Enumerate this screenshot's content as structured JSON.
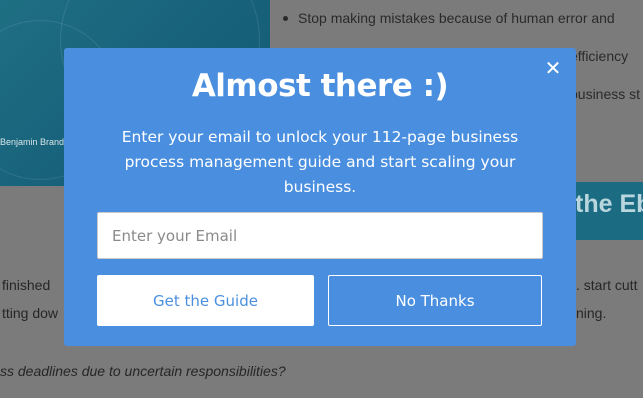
{
  "background": {
    "cover_author": "Benjamin Brandall",
    "bullets": [
      "Stop making mistakes because of human error and",
      "efficiency",
      "business st"
    ],
    "banner_text": "the Eb",
    "text_left_1": "finished",
    "text_left_2": "tting dow",
    "text_right_1": ". start cutt",
    "text_right_2": "ning.",
    "italic_line": "ss deadlines due to uncertain responsibilities?"
  },
  "modal": {
    "title": "Almost there :)",
    "description": "Enter your email to unlock your 112-page business process management guide and start scaling your business.",
    "email_placeholder": "Enter your Email",
    "email_value": "",
    "primary_button": "Get the Guide",
    "secondary_button": "No Thanks",
    "close_symbol": "✕",
    "accent_color": "#4a8fdf"
  }
}
